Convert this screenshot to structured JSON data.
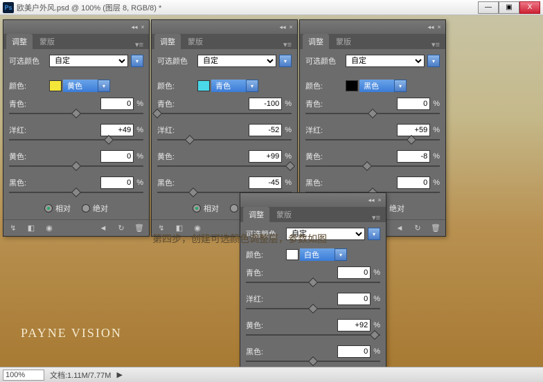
{
  "window": {
    "title": "欧美户外风.psd @ 100% (图层 8, RGB/8) *"
  },
  "winbtns": {
    "min": "—",
    "max": "▣",
    "close": "X"
  },
  "tabs": {
    "adjust": "调整",
    "mask": "蒙版"
  },
  "labels": {
    "preset": "可选颜色",
    "color": "颜色:",
    "cyan": "青色:",
    "magenta": "洋红:",
    "yellow": "黄色:",
    "black": "黑色:",
    "relative": "相对",
    "absolute": "绝对",
    "pct": "%"
  },
  "panel1": {
    "preset": "自定",
    "color_name": "黄色",
    "swatch": "#f5e63a",
    "cyan": "0",
    "magenta": "+49",
    "yellow": "0",
    "black": "0"
  },
  "panel2": {
    "preset": "自定",
    "color_name": "青色",
    "swatch": "#4ad8e8",
    "cyan": "-100",
    "magenta": "-52",
    "yellow": "+99",
    "black": "-45"
  },
  "panel3": {
    "preset": "自定",
    "color_name": "黑色",
    "swatch": "#000000",
    "cyan": "0",
    "magenta": "+59",
    "yellow": "-8",
    "black": "0"
  },
  "panel4": {
    "preset": "自定",
    "color_name": "白色",
    "swatch": "#ffffff",
    "cyan": "0",
    "magenta": "0",
    "yellow": "+92",
    "black": "0"
  },
  "caption": "第四步，创建可选颜色调整层，参数如图",
  "watermark": "PAYNE VISION",
  "status": {
    "zoom": "100%",
    "doc": "文档:1.11M/7.77M",
    "arrow": "▶"
  }
}
